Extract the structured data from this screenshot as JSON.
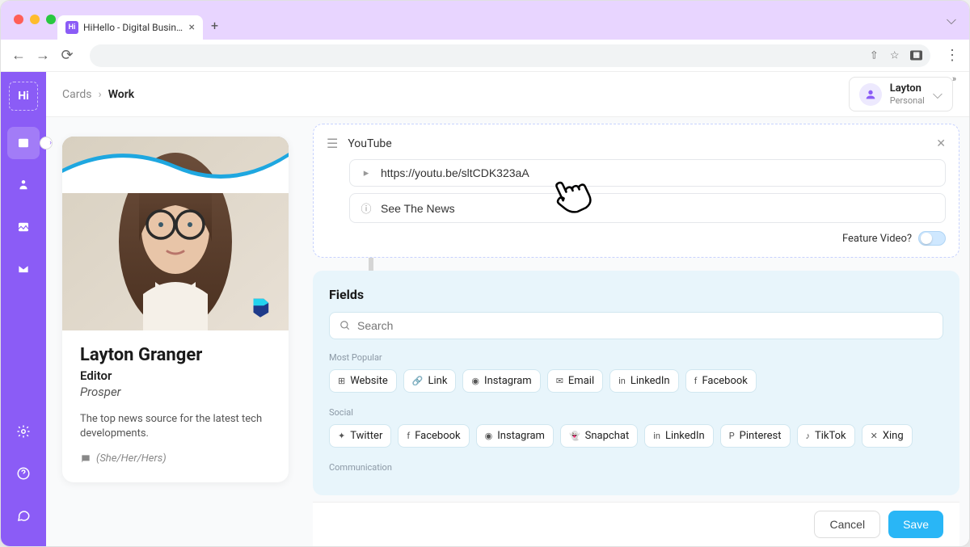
{
  "browser": {
    "tab_title": "HiHello - Digital Business Card"
  },
  "sidebar": {
    "logo_text": "Hi"
  },
  "breadcrumb": {
    "root": "Cards",
    "current": "Work"
  },
  "user": {
    "name": "Layton",
    "sub": "Personal"
  },
  "card": {
    "name": "Layton Granger",
    "title": "Editor",
    "company": "Prosper",
    "description": "The top news source for the latest tech developments.",
    "pronouns": "(She/Her/Hers)"
  },
  "youtube_field": {
    "label": "YouTube",
    "url": "https://youtu.be/sltCDK323aA",
    "title": "See The News",
    "feature_label": "Feature Video?"
  },
  "fields_panel": {
    "title": "Fields",
    "search_placeholder": "Search",
    "groups": {
      "most_popular": {
        "label": "Most Popular",
        "items": [
          "Website",
          "Link",
          "Instagram",
          "Email",
          "LinkedIn",
          "Facebook"
        ]
      },
      "social": {
        "label": "Social",
        "items": [
          "Twitter",
          "Facebook",
          "Instagram",
          "Snapchat",
          "LinkedIn",
          "Pinterest",
          "TikTok",
          "Xing"
        ]
      },
      "communication": {
        "label": "Communication"
      }
    }
  },
  "footer": {
    "cancel": "Cancel",
    "save": "Save"
  }
}
